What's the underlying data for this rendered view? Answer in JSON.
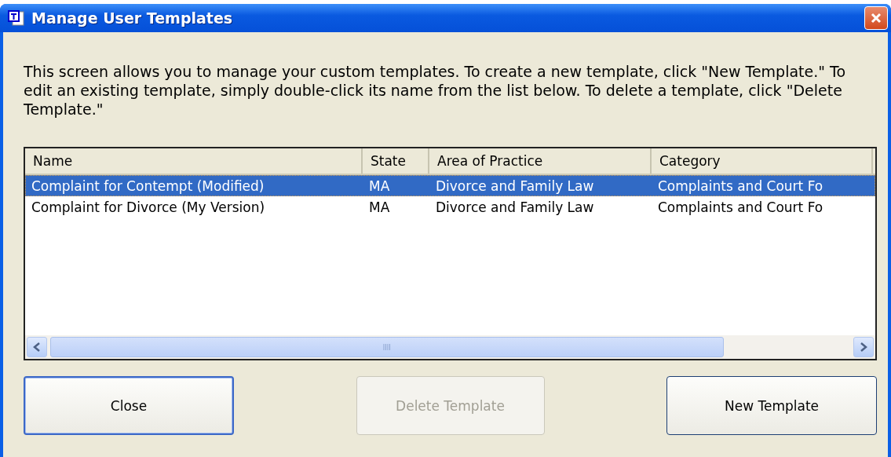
{
  "window": {
    "title": "Manage User Templates"
  },
  "description": "This screen allows you to manage your custom templates. To create a new template, click \"New Template.\" To edit an existing template, simply double-click its name from the list below. To delete a template, click \"Delete Template.\"",
  "table": {
    "columns": [
      "Name",
      "State",
      "Area of Practice",
      "Category"
    ],
    "rows": [
      {
        "cells": [
          "Complaint for Contempt (Modified)",
          "MA",
          "Divorce and Family Law",
          "Complaints and Court Fo"
        ],
        "selected": true
      },
      {
        "cells": [
          "Complaint for Divorce (My Version)",
          "MA",
          "Divorce and Family Law",
          "Complaints and Court Fo"
        ],
        "selected": false
      }
    ]
  },
  "buttons": [
    {
      "label": "Close",
      "disabled": false,
      "default": true
    },
    {
      "label": "Delete Template",
      "disabled": true,
      "default": false
    },
    {
      "label": "New Template",
      "disabled": false,
      "default": false
    }
  ]
}
